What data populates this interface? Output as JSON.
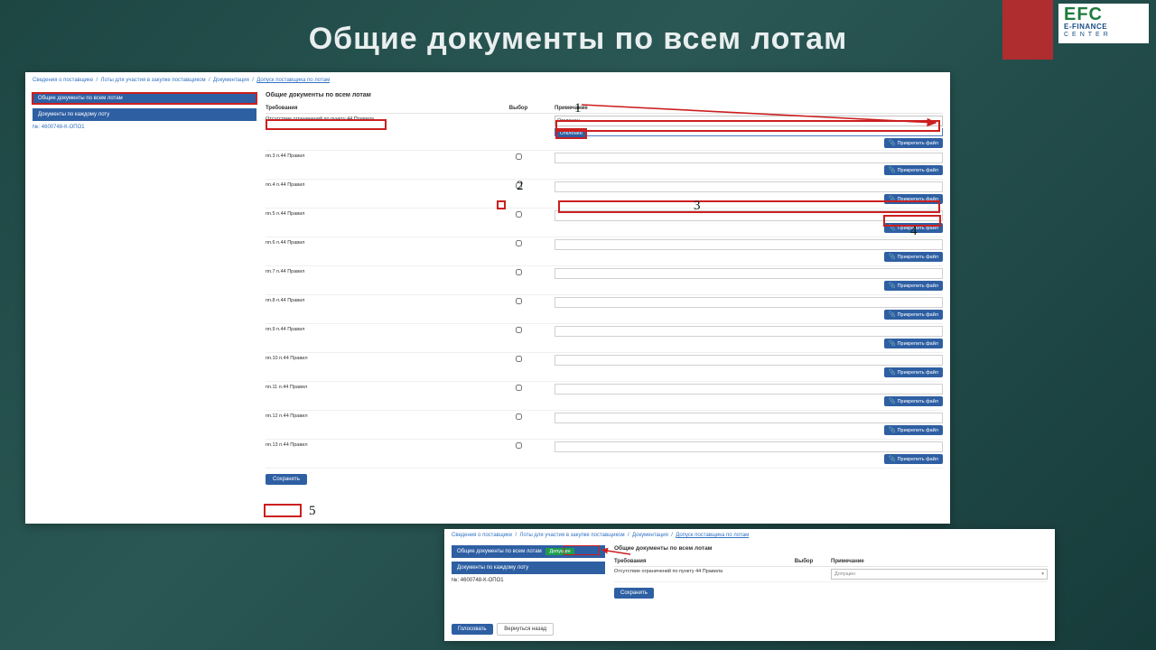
{
  "slide": {
    "title": "Общие документы по всем лотам"
  },
  "logo": {
    "big": "EFC",
    "mid": "E-FINANCE",
    "sm": "CENTER"
  },
  "breadcrumb": [
    "Сведения о поставщике",
    "Лоты для участия в закупке поставщиком",
    "Документация",
    "Допуск поставщика по лотам"
  ],
  "sidebar": {
    "tab_all": "Общие документы по всем лотам",
    "tab_each": "Документы по каждому лоту",
    "code_label": "№:",
    "code": "4600748-К-ОПО1"
  },
  "content": {
    "section_title": "Общие документы по всем лотам",
    "headers": {
      "req": "Требования",
      "sel": "Выбор",
      "note": "Примечание"
    },
    "absence_text": "Отсутствие ограничений по пункту 44 Правила",
    "select_value": "Отклонен",
    "options": [
      "Отклонен",
      "Допущен"
    ],
    "attach_label": "Прикрепить файл",
    "rows": [
      {
        "req": "пп.3 п.44 Правил"
      },
      {
        "req": "пп.4 п.44 Правил"
      },
      {
        "req": "пп.5 п.44 Правил"
      },
      {
        "req": "пп.6 п.44 Правил"
      },
      {
        "req": "пп.7 п.44 Правил"
      },
      {
        "req": "пп.8 п.44 Правил"
      },
      {
        "req": "пп.9 п.44 Правил"
      },
      {
        "req": "пп.10 п.44 Правил"
      },
      {
        "req": "пп.11 п.44 Правил"
      },
      {
        "req": "пп.12 п.44 Правил"
      },
      {
        "req": "пп.13 п.44 Правил"
      }
    ],
    "save": "Сохранить"
  },
  "annotations": {
    "n1": "1",
    "n2": "2",
    "n3": "3",
    "n4": "4",
    "n5": "5"
  },
  "small": {
    "breadcrumb": [
      "Сведения о поставщике",
      "Лоты для участия в закупке поставщиком",
      "Документация",
      "Допуск поставщика по лотам"
    ],
    "tab_all": "Общие документы по всем лотам",
    "badge": "Допущен",
    "tab_each": "Документы по каждому лоту",
    "code_label": "№:",
    "code": "4600748-К-ОПО1",
    "section_title": "Общие документы по всем лотам",
    "headers": {
      "req": "Требования",
      "sel": "Выбор",
      "note": "Примечание"
    },
    "absence_text": "Отсутствие ограничений по пункту 44 Правила",
    "select_value": "Допущен",
    "save": "Сохранить",
    "vote": "Голосовать",
    "back": "Вернуться назад"
  }
}
